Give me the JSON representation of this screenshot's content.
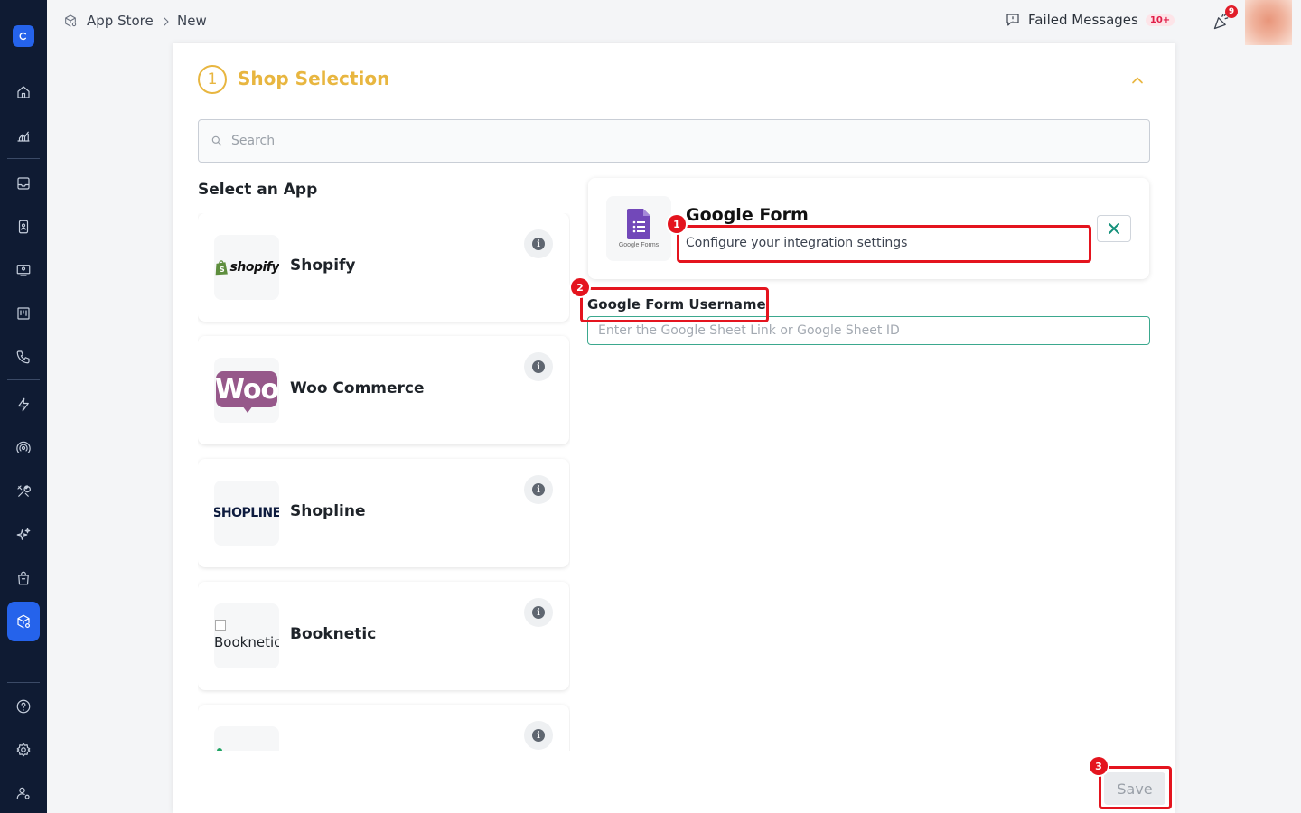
{
  "breadcrumb": {
    "items": [
      "App Store",
      "New"
    ]
  },
  "topbar": {
    "failed_messages_label": "Failed Messages",
    "failed_messages_count": "10+",
    "notification_count": "9"
  },
  "section": {
    "step_number": "1",
    "title": "Shop Selection"
  },
  "search": {
    "placeholder": "Search"
  },
  "app_list": {
    "heading": "Select an App",
    "apps": [
      {
        "name": "Shopify",
        "logo_text": "shopify"
      },
      {
        "name": "Woo Commerce",
        "logo_text": "Woo"
      },
      {
        "name": "Shopline",
        "logo_text": "SHOPLINE"
      },
      {
        "name": "Booknetic",
        "logo_alt": "Booknetic"
      },
      {
        "name": ""
      }
    ]
  },
  "selected_app": {
    "name": "Google Form",
    "subtitle": "Configure your integration settings",
    "logo_caption": "Google Forms"
  },
  "form": {
    "username_label": "Google Form Username",
    "username_placeholder": "Enter the Google Sheet Link or Google Sheet ID"
  },
  "footer": {
    "save_label": "Save"
  },
  "annotations": {
    "labels": [
      "1",
      "2",
      "3"
    ],
    "color": "#e4141e"
  },
  "colors": {
    "accent": "#e8b640",
    "sidebar": "#0f1b33",
    "primary": "#2563eb",
    "input_focus": "#3ba88e"
  }
}
